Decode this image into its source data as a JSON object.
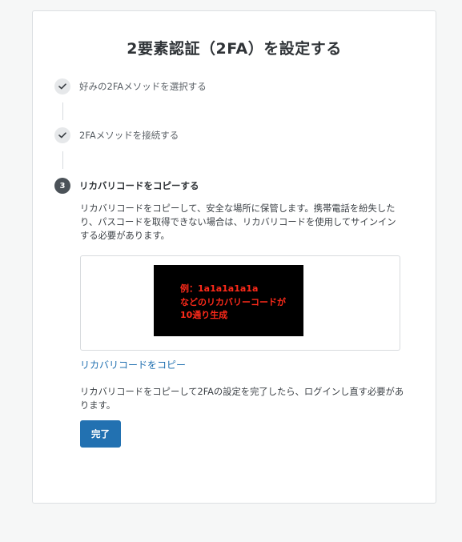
{
  "page": {
    "title": "2要素認証（2FA）を設定する"
  },
  "steps": [
    {
      "label": "好みの2FAメソッドを選択する",
      "status": "done",
      "icon": "check-icon"
    },
    {
      "label": "2FAメソッドを接続する",
      "status": "done",
      "icon": "check-icon"
    },
    {
      "label": "リカバリコードをコピーする",
      "status": "current",
      "number": "3"
    }
  ],
  "recovery": {
    "description": "リカバリコードをコピーして、安全な場所に保管します。携帯電話を紛失したり、パスコードを取得できない場合は、リカバリコードを使用してサインインする必要があります。",
    "code_lines": [
      "例：1a1a1a1a1a",
      "などのリカバリーコードが",
      "10通り生成"
    ],
    "copy_link": "リカバリコードをコピー",
    "note": "リカバリコードをコピーして2FAの設定を完了したら、ログインし直す必要があります。",
    "done_button": "完了"
  },
  "colors": {
    "primary": "#2271b1",
    "code_text": "#ff2a1a",
    "code_background": "#000000",
    "step_current": "#4b5258"
  }
}
